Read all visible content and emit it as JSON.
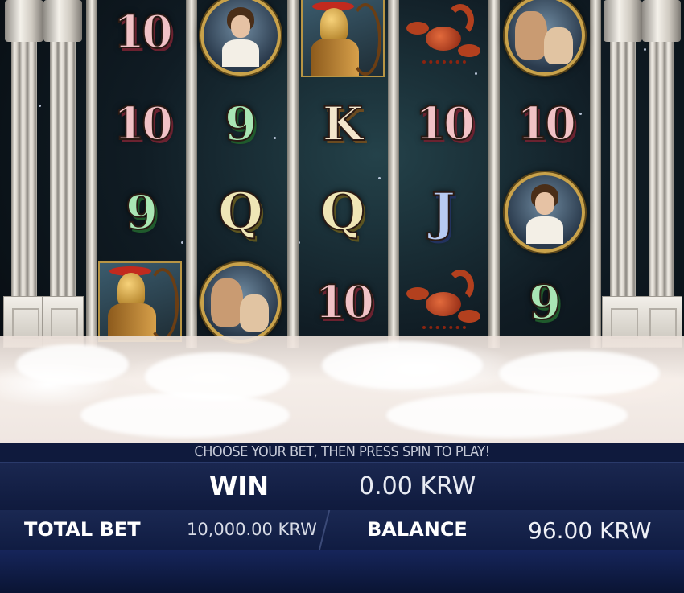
{
  "game": {
    "reels": [
      [
        "10",
        "10",
        "9",
        "warrior"
      ],
      [
        "lady",
        "9",
        "Q",
        "dogs"
      ],
      [
        "warrior",
        "K",
        "Q",
        "10"
      ],
      [
        "scorpion",
        "10",
        "J",
        "scorpion"
      ],
      [
        "dogs",
        "10",
        "lady",
        "9"
      ]
    ]
  },
  "hud": {
    "prompt": "CHOOSE YOUR BET, THEN PRESS SPIN TO PLAY!",
    "win_label": "WIN",
    "win_value": "0.00 KRW",
    "total_bet_label": "TOTAL BET",
    "total_bet_value": "10,000.00 KRW",
    "balance_label": "BALANCE",
    "balance_value": "96.00 KRW"
  }
}
